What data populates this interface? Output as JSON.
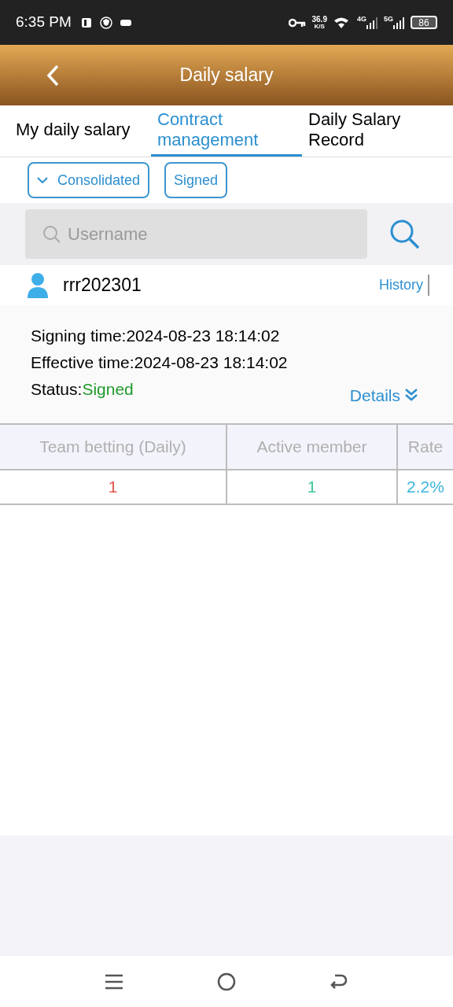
{
  "status_bar": {
    "time": "6:35 PM",
    "speed_value": "36.9",
    "speed_unit": "K/S",
    "network_1": "4G",
    "network_2": "5G",
    "battery": "86"
  },
  "header": {
    "title": "Daily salary"
  },
  "tabs": [
    {
      "label": "My daily salary",
      "selected": false
    },
    {
      "label": "Contract management",
      "selected": true
    },
    {
      "label": "Daily Salary Record",
      "selected": false
    }
  ],
  "filters": [
    {
      "label": "Consolidated",
      "kind": "dropdown"
    },
    {
      "label": "Signed",
      "kind": "button"
    }
  ],
  "search": {
    "placeholder": "Username"
  },
  "contract": {
    "username": "rrr202301",
    "history_link": "History",
    "lines": [
      {
        "label": "Signing time:",
        "value": "2024-08-23 18:14:02"
      },
      {
        "label": "Effective time:",
        "value": "2024-08-23 18:14:02"
      }
    ],
    "status_label": "Status:",
    "status_value": "Signed",
    "details_link": "Details"
  },
  "table": {
    "columns": [
      "Team betting (Daily)",
      "Active member",
      "Rate"
    ],
    "rows": [
      [
        {
          "text": "1",
          "color": "#e0574b"
        },
        {
          "text": "1",
          "color": "#3cc6a0"
        },
        {
          "text": "2.2%",
          "color": "#3ab4dc"
        }
      ]
    ]
  }
}
